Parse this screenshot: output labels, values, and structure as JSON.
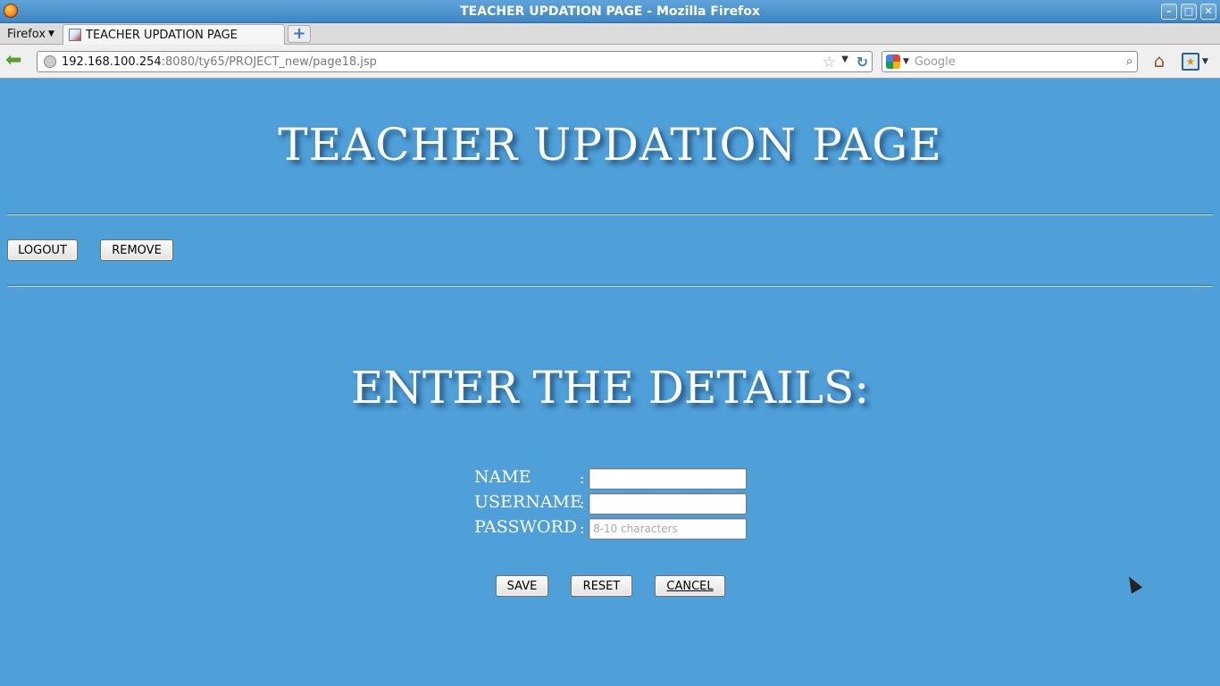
{
  "window": {
    "title": "TEACHER UPDATION PAGE - Mozilla Firefox",
    "controls": [
      "–",
      "□",
      "✕"
    ]
  },
  "browser": {
    "menu_label": "Firefox",
    "tab_title": "TEACHER UPDATION PAGE",
    "new_tab_label": "+",
    "url_host": "192.168.100.254",
    "url_path": ":8080/ty65/PROJECT_new/page18.jsp",
    "search_placeholder": "Google",
    "icons": {
      "back": "back-arrow-icon",
      "reload": "reload-icon",
      "bookmark_star": "star-icon",
      "search": "magnifier-icon",
      "home": "home-icon",
      "bookmarks": "bookmarks-icon"
    }
  },
  "page": {
    "title": "TEACHER UPDATION PAGE",
    "top_buttons": {
      "logout": "LOGOUT",
      "remove": "REMOVE"
    },
    "section_title": "ENTER THE DETAILS:",
    "form": {
      "separator": ":",
      "name_label": "NAME",
      "username_label": "USERNAME",
      "password_label": "PASSWORD",
      "name_value": "",
      "username_value": "",
      "password_value": "",
      "password_placeholder": "8-10 characters"
    },
    "form_buttons": {
      "save": "SAVE",
      "reset": "RESET",
      "cancel": "CANCEL"
    },
    "colors": {
      "background": "#4f9fd9",
      "heading_text": "#ffffff"
    }
  }
}
